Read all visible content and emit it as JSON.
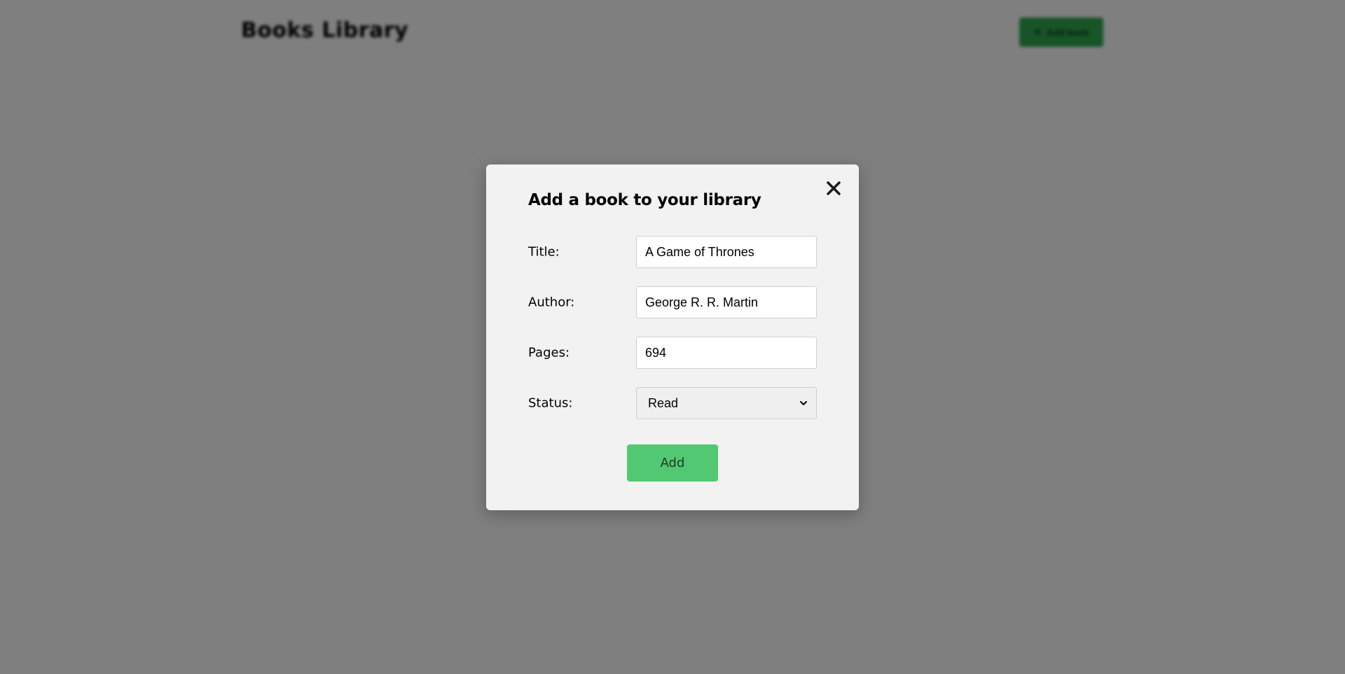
{
  "app": {
    "brand": "Books Library",
    "header_button_label": "Add book",
    "accent_color": "#52c873"
  },
  "modal": {
    "title": "Add a book to your library",
    "close_icon": "close-icon",
    "fields": {
      "title": {
        "label": "Title:",
        "value": "A Game of Thrones"
      },
      "author": {
        "label": "Author:",
        "value": "George R. R. Martin"
      },
      "pages": {
        "label": "Pages:",
        "value": "694"
      },
      "status": {
        "label": "Status:",
        "selected": "Read"
      }
    },
    "submit_label": "Add"
  }
}
